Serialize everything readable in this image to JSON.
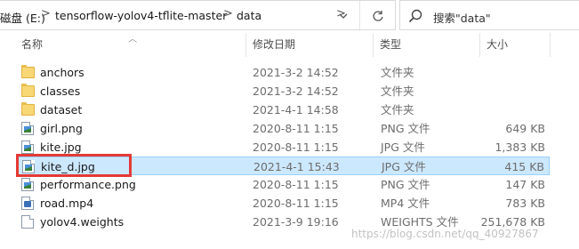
{
  "address_bar": {
    "drive": "磁盘 (E:)",
    "folder": "tensorflow-yolov4-tflite-master",
    "current": "data",
    "separators": [
      ">",
      ">",
      ">"
    ],
    "dropdown_icon": "chevron-down-icon",
    "refresh_icon": "refresh-icon"
  },
  "search": {
    "placeholder": "搜索\"data\"",
    "icon": "search-icon"
  },
  "columns": {
    "name": "名称",
    "date": "修改日期",
    "type": "类型",
    "size": "大小"
  },
  "files": [
    {
      "name": "anchors",
      "date": "2021-3-2 14:52",
      "type": "文件夹",
      "size": "",
      "icon": "folder-icon"
    },
    {
      "name": "classes",
      "date": "2021-3-2 14:52",
      "type": "文件夹",
      "size": "",
      "icon": "folder-icon"
    },
    {
      "name": "dataset",
      "date": "2021-4-1 14:58",
      "type": "文件夹",
      "size": "",
      "icon": "folder-icon"
    },
    {
      "name": "girl.png",
      "date": "2020-8-11 1:15",
      "type": "PNG 文件",
      "size": "649 KB",
      "icon": "image-file-icon"
    },
    {
      "name": "kite.jpg",
      "date": "2020-8-11 1:15",
      "type": "JPG 文件",
      "size": "1,383 KB",
      "icon": "image-file-icon"
    },
    {
      "name": "kite_d.jpg",
      "date": "2021-4-1 15:43",
      "type": "JPG 文件",
      "size": "415 KB",
      "icon": "image-file-icon",
      "selected": true
    },
    {
      "name": "performance.png",
      "date": "2020-8-11 1:15",
      "type": "PNG 文件",
      "size": "147 KB",
      "icon": "image-file-icon"
    },
    {
      "name": "road.mp4",
      "date": "2020-8-11 1:15",
      "type": "MP4 文件",
      "size": "783 KB",
      "icon": "video-file-icon"
    },
    {
      "name": "yolov4.weights",
      "date": "2021-3-9 19:16",
      "type": "WEIGHTS 文件",
      "size": "251,678 KB",
      "icon": "blank-file-icon"
    }
  ],
  "colors": {
    "selection_bg": "#cce8ff",
    "selection_border": "#99d1ff",
    "annotation_box": "#e53935",
    "folder": "#f8d775"
  },
  "watermark": "https://blog.csdn.net/qq_40927867"
}
